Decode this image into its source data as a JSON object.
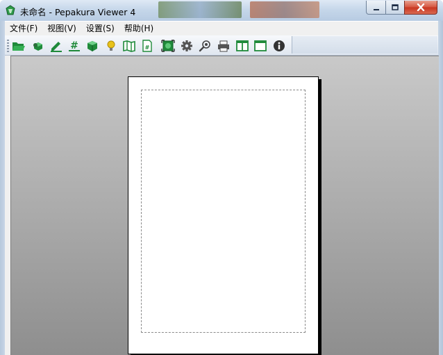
{
  "window": {
    "title": "未命名 - Pepakura Viewer 4",
    "app_icon": "pepakura-logo-icon",
    "caption_buttons": [
      "minimize-icon",
      "maximize-icon",
      "close-icon"
    ]
  },
  "menu": {
    "items": [
      {
        "label": "文件(F)"
      },
      {
        "label": "视图(V)"
      },
      {
        "label": "设置(S)"
      },
      {
        "label": "帮助(H)"
      }
    ]
  },
  "toolbar": {
    "buttons": [
      {
        "icon": "open-folder-icon"
      },
      {
        "icon": "3d-parts-icon"
      },
      {
        "icon": "pencil-edit-icon"
      },
      {
        "icon": "number-sign-icon"
      },
      {
        "icon": "cube-icon"
      },
      {
        "icon": "light-bulb-icon"
      },
      {
        "icon": "map-book-icon"
      },
      {
        "icon": "page-number-icon"
      },
      {
        "icon": "fit-view-icon"
      },
      {
        "icon": "gear-icon"
      },
      {
        "icon": "view-eye-icon"
      },
      {
        "icon": "printer-icon"
      },
      {
        "icon": "split-view-icon"
      },
      {
        "icon": "single-view-icon"
      },
      {
        "icon": "info-icon"
      }
    ]
  },
  "colors": {
    "icon_green": "#1f8a3a",
    "bulb_yellow": "#e8c21a",
    "close_red": "#c8351f"
  }
}
